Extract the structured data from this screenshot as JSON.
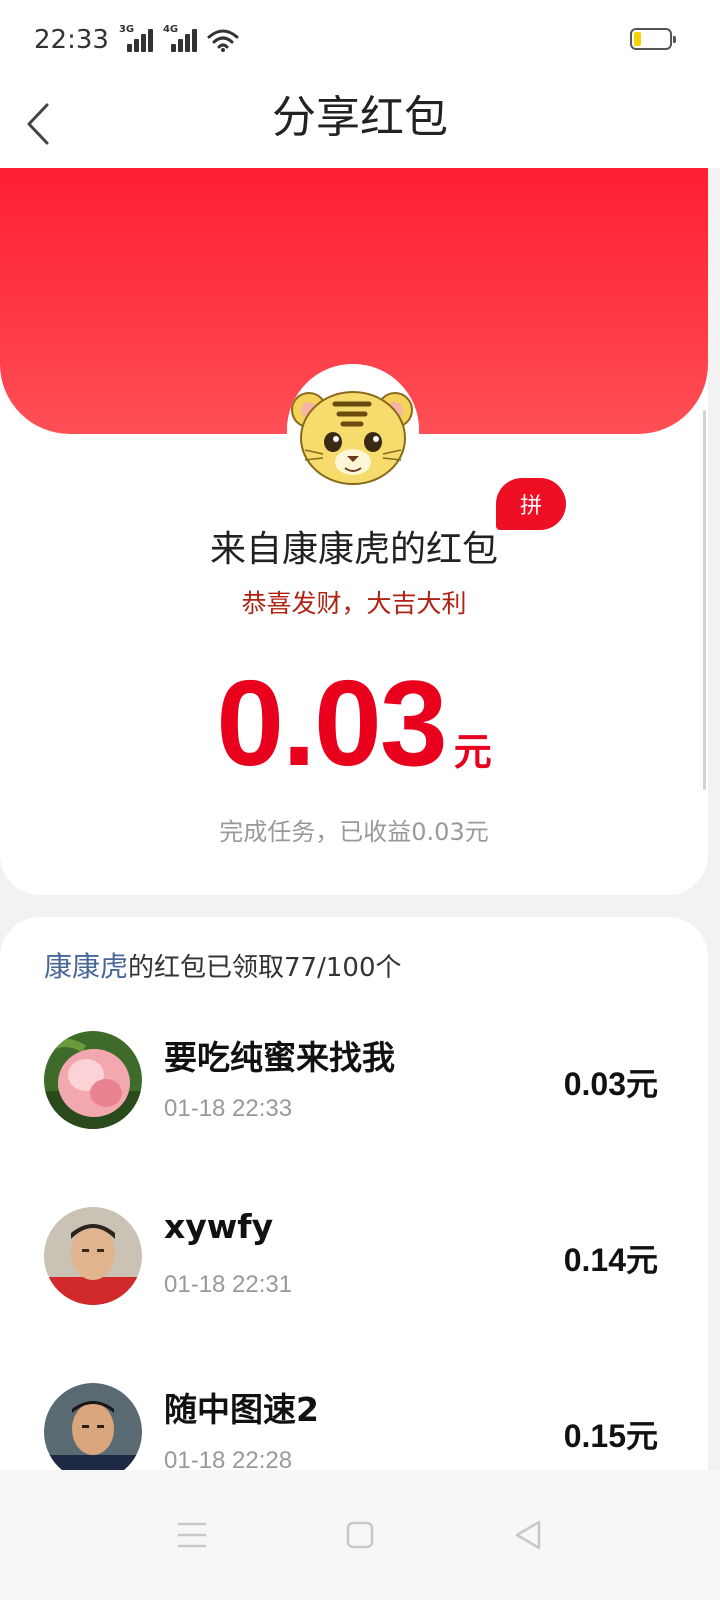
{
  "status_bar": {
    "time": "22:33",
    "signal_1_label": "3G",
    "signal_2_label": "4G",
    "battery_level": 0.2
  },
  "header": {
    "title": "分享红包"
  },
  "packet": {
    "from": "来自康康虎的红包",
    "badge": "拼",
    "greeting": "恭喜发财，大吉大利",
    "amount": "0.03",
    "unit": "元",
    "task_note": "完成任务，已收益0.03元"
  },
  "claims": {
    "owner": "康康虎",
    "summary": "的红包已领取77/100个",
    "items": [
      {
        "name": "要吃纯蜜来找我",
        "time": "01-18 22:33",
        "amount": "0.03",
        "unit": "元"
      },
      {
        "name": "xywfy",
        "time": "01-18 22:31",
        "amount": "0.14",
        "unit": "元"
      },
      {
        "name": "随中图速2",
        "time": "01-18 22:28",
        "amount": "0.15",
        "unit": "元"
      }
    ]
  },
  "colors": {
    "brand_red": "#ef0f25",
    "amount_red": "#e8001d",
    "owner_blue": "#4a6799"
  }
}
